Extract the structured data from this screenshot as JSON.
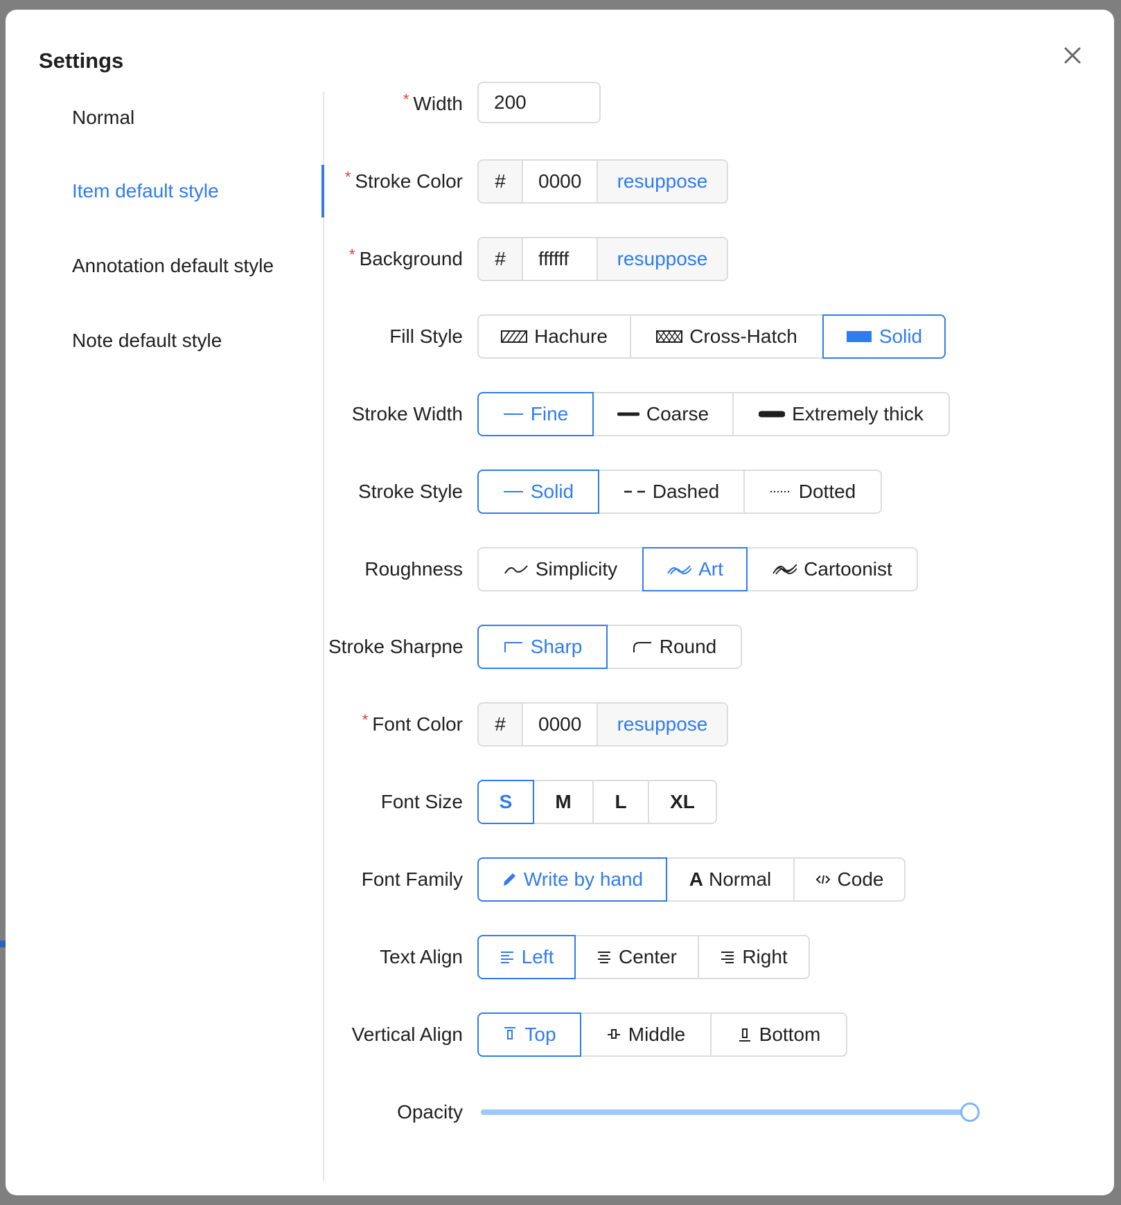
{
  "dialog": {
    "title": "Settings"
  },
  "nav": {
    "items": [
      {
        "label": "Normal"
      },
      {
        "label": "Item default style"
      },
      {
        "label": "Annotation default style"
      },
      {
        "label": "Note default style"
      }
    ],
    "active_index": 1
  },
  "form": {
    "width": {
      "label": "Width",
      "required": true,
      "value": "200"
    },
    "stroke_color": {
      "label": "Stroke Color",
      "required": true,
      "prefix": "#",
      "value": "0000",
      "button": "resuppose"
    },
    "background": {
      "label": "Background",
      "required": true,
      "prefix": "#",
      "value": "ffffff",
      "button": "resuppose"
    },
    "fill_style": {
      "label": "Fill Style",
      "options": [
        "Hachure",
        "Cross-Hatch",
        "Solid"
      ],
      "selected": "Solid"
    },
    "stroke_width": {
      "label": "Stroke Width",
      "options": [
        "Fine",
        "Coarse",
        "Extremely thick"
      ],
      "selected": "Fine"
    },
    "stroke_style": {
      "label": "Stroke Style",
      "options": [
        "Solid",
        "Dashed",
        "Dotted"
      ],
      "selected": "Solid"
    },
    "roughness": {
      "label": "Roughness",
      "options": [
        "Simplicity",
        "Art",
        "Cartoonist"
      ],
      "selected": "Art"
    },
    "stroke_sharpness": {
      "label": "Stroke Sharpness",
      "options": [
        "Sharp",
        "Round"
      ],
      "selected": "Sharp"
    },
    "font_color": {
      "label": "Font Color",
      "required": true,
      "prefix": "#",
      "value": "0000",
      "button": "resuppose"
    },
    "font_size": {
      "label": "Font Size",
      "options": [
        "S",
        "M",
        "L",
        "XL"
      ],
      "selected": "S"
    },
    "font_family": {
      "label": "Font Family",
      "options": [
        "Write by hand",
        "Normal",
        "Code"
      ],
      "selected": "Write by hand"
    },
    "text_align": {
      "label": "Text Align",
      "options": [
        "Left",
        "Center",
        "Right"
      ],
      "selected": "Left"
    },
    "vertical_align": {
      "label": "Vertical Align",
      "options": [
        "Top",
        "Middle",
        "Bottom"
      ],
      "selected": "Top"
    },
    "opacity": {
      "label": "Opacity",
      "value": 1.0
    }
  },
  "colors": {
    "accent": "#2f7bf0",
    "required": "#e53935",
    "border": "#dcdcdc",
    "slider_track": "#9ec8fb"
  }
}
